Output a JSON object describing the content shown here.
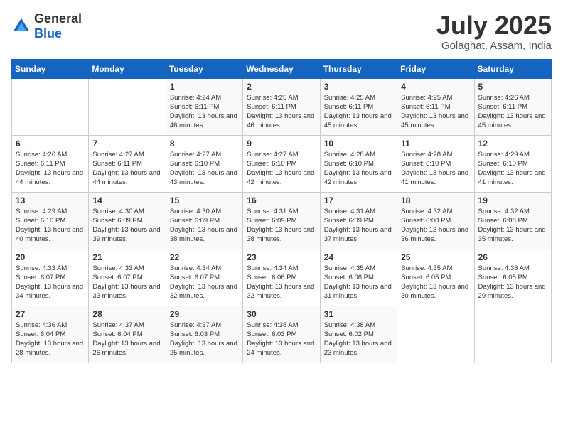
{
  "header": {
    "logo_general": "General",
    "logo_blue": "Blue",
    "title": "July 2025",
    "subtitle": "Golaghat, Assam, India"
  },
  "days_of_week": [
    "Sunday",
    "Monday",
    "Tuesday",
    "Wednesday",
    "Thursday",
    "Friday",
    "Saturday"
  ],
  "weeks": [
    [
      {
        "day": "",
        "info": ""
      },
      {
        "day": "",
        "info": ""
      },
      {
        "day": "1",
        "info": "Sunrise: 4:24 AM\nSunset: 6:11 PM\nDaylight: 13 hours and 46 minutes."
      },
      {
        "day": "2",
        "info": "Sunrise: 4:25 AM\nSunset: 6:11 PM\nDaylight: 13 hours and 46 minutes."
      },
      {
        "day": "3",
        "info": "Sunrise: 4:25 AM\nSunset: 6:11 PM\nDaylight: 13 hours and 45 minutes."
      },
      {
        "day": "4",
        "info": "Sunrise: 4:25 AM\nSunset: 6:11 PM\nDaylight: 13 hours and 45 minutes."
      },
      {
        "day": "5",
        "info": "Sunrise: 4:26 AM\nSunset: 6:11 PM\nDaylight: 13 hours and 45 minutes."
      }
    ],
    [
      {
        "day": "6",
        "info": "Sunrise: 4:26 AM\nSunset: 6:11 PM\nDaylight: 13 hours and 44 minutes."
      },
      {
        "day": "7",
        "info": "Sunrise: 4:27 AM\nSunset: 6:11 PM\nDaylight: 13 hours and 44 minutes."
      },
      {
        "day": "8",
        "info": "Sunrise: 4:27 AM\nSunset: 6:10 PM\nDaylight: 13 hours and 43 minutes."
      },
      {
        "day": "9",
        "info": "Sunrise: 4:27 AM\nSunset: 6:10 PM\nDaylight: 13 hours and 42 minutes."
      },
      {
        "day": "10",
        "info": "Sunrise: 4:28 AM\nSunset: 6:10 PM\nDaylight: 13 hours and 42 minutes."
      },
      {
        "day": "11",
        "info": "Sunrise: 4:28 AM\nSunset: 6:10 PM\nDaylight: 13 hours and 41 minutes."
      },
      {
        "day": "12",
        "info": "Sunrise: 4:29 AM\nSunset: 6:10 PM\nDaylight: 13 hours and 41 minutes."
      }
    ],
    [
      {
        "day": "13",
        "info": "Sunrise: 4:29 AM\nSunset: 6:10 PM\nDaylight: 13 hours and 40 minutes."
      },
      {
        "day": "14",
        "info": "Sunrise: 4:30 AM\nSunset: 6:09 PM\nDaylight: 13 hours and 39 minutes."
      },
      {
        "day": "15",
        "info": "Sunrise: 4:30 AM\nSunset: 6:09 PM\nDaylight: 13 hours and 38 minutes."
      },
      {
        "day": "16",
        "info": "Sunrise: 4:31 AM\nSunset: 6:09 PM\nDaylight: 13 hours and 38 minutes."
      },
      {
        "day": "17",
        "info": "Sunrise: 4:31 AM\nSunset: 6:09 PM\nDaylight: 13 hours and 37 minutes."
      },
      {
        "day": "18",
        "info": "Sunrise: 4:32 AM\nSunset: 6:08 PM\nDaylight: 13 hours and 36 minutes."
      },
      {
        "day": "19",
        "info": "Sunrise: 4:32 AM\nSunset: 6:08 PM\nDaylight: 13 hours and 35 minutes."
      }
    ],
    [
      {
        "day": "20",
        "info": "Sunrise: 4:33 AM\nSunset: 6:07 PM\nDaylight: 13 hours and 34 minutes."
      },
      {
        "day": "21",
        "info": "Sunrise: 4:33 AM\nSunset: 6:07 PM\nDaylight: 13 hours and 33 minutes."
      },
      {
        "day": "22",
        "info": "Sunrise: 4:34 AM\nSunset: 6:07 PM\nDaylight: 13 hours and 32 minutes."
      },
      {
        "day": "23",
        "info": "Sunrise: 4:34 AM\nSunset: 6:06 PM\nDaylight: 13 hours and 32 minutes."
      },
      {
        "day": "24",
        "info": "Sunrise: 4:35 AM\nSunset: 6:06 PM\nDaylight: 13 hours and 31 minutes."
      },
      {
        "day": "25",
        "info": "Sunrise: 4:35 AM\nSunset: 6:05 PM\nDaylight: 13 hours and 30 minutes."
      },
      {
        "day": "26",
        "info": "Sunrise: 4:36 AM\nSunset: 6:05 PM\nDaylight: 13 hours and 29 minutes."
      }
    ],
    [
      {
        "day": "27",
        "info": "Sunrise: 4:36 AM\nSunset: 6:04 PM\nDaylight: 13 hours and 28 minutes."
      },
      {
        "day": "28",
        "info": "Sunrise: 4:37 AM\nSunset: 6:04 PM\nDaylight: 13 hours and 26 minutes."
      },
      {
        "day": "29",
        "info": "Sunrise: 4:37 AM\nSunset: 6:03 PM\nDaylight: 13 hours and 25 minutes."
      },
      {
        "day": "30",
        "info": "Sunrise: 4:38 AM\nSunset: 6:03 PM\nDaylight: 13 hours and 24 minutes."
      },
      {
        "day": "31",
        "info": "Sunrise: 4:38 AM\nSunset: 6:02 PM\nDaylight: 13 hours and 23 minutes."
      },
      {
        "day": "",
        "info": ""
      },
      {
        "day": "",
        "info": ""
      }
    ]
  ]
}
